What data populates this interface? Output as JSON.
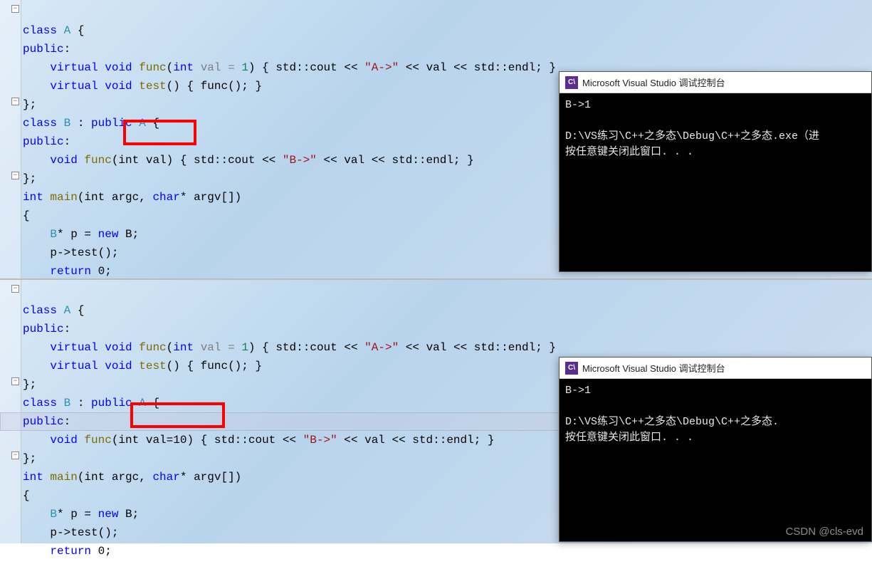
{
  "watermark": "CSDN @cls-evd",
  "fold_glyph": "−",
  "panel1": {
    "console_title": "Microsoft Visual Studio 调试控制台",
    "console_out_line1": "B->1",
    "console_out_line2": "",
    "console_out_line3": "D:\\VS练习\\C++之多态\\Debug\\C++之多态.exe（进",
    "console_out_line4": "按任意键关闭此窗口. . .",
    "code": {
      "l1_class": "class",
      "l1_A": "A",
      "l2_public": "public",
      "l3_virtual": "virtual",
      "l3_void": "void",
      "l3_func": "func",
      "l3_int": "int",
      "l3_val": "val",
      "l3_eq": " = ",
      "l3_one": "1",
      "l3_cout": "std::cout << ",
      "l3_str": "\"A->\"",
      "l3_tail": " << val << std::endl; }",
      "l4_virtual": "virtual",
      "l4_void": "void",
      "l4_test": "test",
      "l4_body": "() { func(); }",
      "l6_class": "class",
      "l6_B": "B",
      "l6_pub": "public",
      "l6_A": "A",
      "l7_public": "public",
      "l8_void": "void",
      "l8_func": "func",
      "l8_param": "(int val)",
      "l8_body": " { std::cout << ",
      "l8_str": "\"B->\"",
      "l8_tail": " << val << std::endl; }",
      "l10_int": "int",
      "l10_main": "main",
      "l10_args": "(int argc, ",
      "l10_char": "char",
      "l10_argv": "* argv[])",
      "l12_B": "B",
      "l12_p": "* p = ",
      "l12_new": "new",
      "l12_B2": " B;",
      "l13_ptest": "p->test();",
      "l14_return": "return",
      "l14_zero": " 0;"
    }
  },
  "panel2": {
    "console_title": "Microsoft Visual Studio 调试控制台",
    "console_out_line1": "B->1",
    "console_out_line2": "",
    "console_out_line3": "D:\\VS练习\\C++之多态\\Debug\\C++之多态.",
    "console_out_line4": "按任意键关闭此窗口. . .",
    "code": {
      "l8_param": "(int val=10)"
    }
  }
}
